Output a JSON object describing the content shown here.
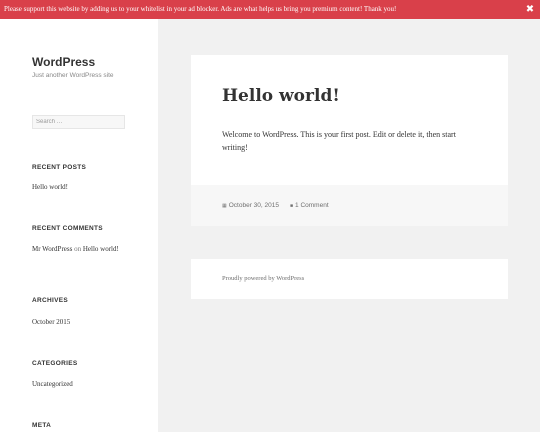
{
  "notice": {
    "message": "Please support this website by adding us to your whitelist in your ad blocker. Ads are what helps us bring you premium content! Thank you!",
    "close_icon": "close-icon",
    "color": "#d9404a"
  },
  "site": {
    "title": "WordPress",
    "description": "Just another WordPress site"
  },
  "search": {
    "placeholder": "Search …"
  },
  "widgets": {
    "recent_posts": {
      "title": "RECENT POSTS",
      "items": [
        "Hello world!"
      ]
    },
    "recent_comments": {
      "title": "RECENT COMMENTS",
      "author": "Mr WordPress",
      "on": "on",
      "post": "Hello world!"
    },
    "archives": {
      "title": "ARCHIVES",
      "items": [
        "October 2015"
      ]
    },
    "categories": {
      "title": "CATEGORIES",
      "items": [
        "Uncategorized"
      ]
    },
    "meta": {
      "title": "META"
    }
  },
  "post": {
    "title": "Hello world!",
    "body": "Welcome to WordPress. This is your first post. Edit or delete it, then start writing!",
    "date": "October 30, 2015",
    "date_icon": "calendar-icon",
    "comments": "1 Comment",
    "comments_icon": "comment-icon"
  },
  "footer": {
    "credit": "Proudly powered by WordPress"
  }
}
